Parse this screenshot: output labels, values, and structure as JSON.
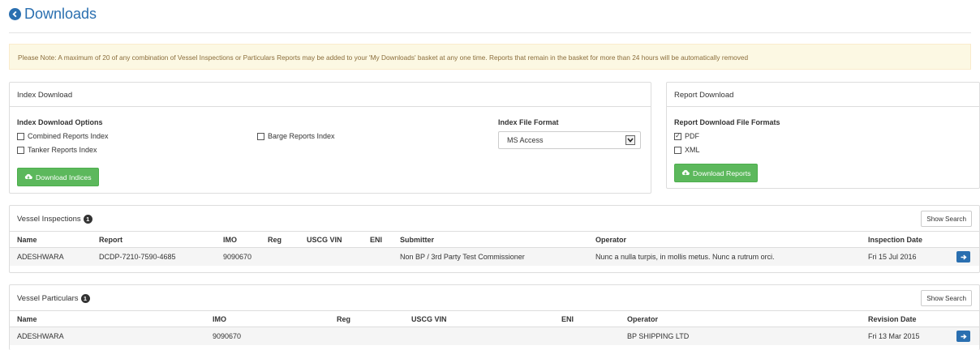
{
  "page": {
    "title": "Downloads"
  },
  "notice": {
    "text": "Please Note: A maximum of 20 of any combination of Vessel Inspections or Particulars Reports may be added to your 'My Downloads' basket at any one time. Reports that remain in the basket for more than 24 hours will be automatically removed"
  },
  "index_download": {
    "heading": "Index Download",
    "options_label": "Index Download Options",
    "options": [
      {
        "label": "Combined Reports Index",
        "checked": false
      },
      {
        "label": "Tanker Reports Index",
        "checked": false
      },
      {
        "label": "Barge Reports Index",
        "checked": false
      }
    ],
    "format_label": "Index File Format",
    "format_value": "MS Access",
    "button": "Download Indices"
  },
  "report_download": {
    "heading": "Report Download",
    "formats_label": "Report Download File Formats",
    "formats": [
      {
        "label": "PDF",
        "checked": true
      },
      {
        "label": "XML",
        "checked": false
      }
    ],
    "button": "Download Reports"
  },
  "vessel_inspections": {
    "heading": "Vessel Inspections",
    "count": "1",
    "show_search": "Show Search",
    "columns": [
      "Name",
      "Report",
      "IMO",
      "Reg",
      "USCG VIN",
      "ENI",
      "Submitter",
      "Operator",
      "Inspection Date"
    ],
    "rows": [
      [
        "ADESHWARA",
        "DCDP-7210-7590-4685",
        "9090670",
        "",
        "",
        "",
        "Non BP / 3rd Party Test Commissioner",
        "Nunc a nulla turpis, in mollis metus. Nunc a rutrum orci.",
        "Fri 15 Jul 2016"
      ]
    ]
  },
  "vessel_particulars": {
    "heading": "Vessel Particulars",
    "count": "1",
    "show_search": "Show Search",
    "columns": [
      "Name",
      "IMO",
      "Reg",
      "USCG VIN",
      "ENI",
      "Operator",
      "Revision Date"
    ],
    "rows": [
      [
        "ADESHWARA",
        "9090670",
        "",
        "",
        "",
        "BP SHIPPING LTD",
        "Fri 13 Mar 2015"
      ]
    ]
  },
  "colors": {
    "accent": "#2a6fb0",
    "success": "#5cb85c",
    "notice_bg": "#fcf8e3",
    "notice_text": "#8a6d3b"
  },
  "icons": {
    "back": "chevron-left-circle-icon",
    "download": "cloud-download-icon",
    "row_action": "arrow-right-icon",
    "select": "chevron-down-icon"
  }
}
